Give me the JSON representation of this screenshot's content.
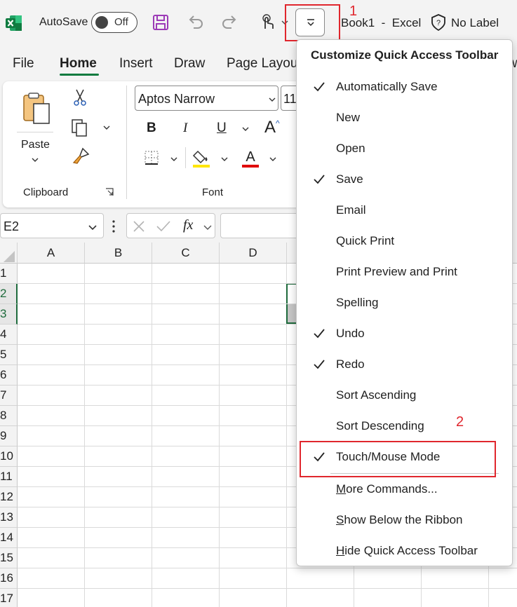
{
  "titlebar": {
    "autosave_label": "AutoSave",
    "autosave_state": "Off",
    "book_title": "Book1  -  Excel",
    "sensitivity_label": "No Label",
    "icons": [
      "excel-logo-icon",
      "save-icon",
      "undo-icon",
      "redo-icon",
      "touch-mode-icon",
      "customize-qat-icon",
      "sensitivity-shield-icon"
    ]
  },
  "menubar": {
    "tabs": [
      "File",
      "Home",
      "Insert",
      "Draw",
      "Page Layout"
    ],
    "active_tab": "Home",
    "overflow_text": "w"
  },
  "ribbon": {
    "paste_label": "Paste",
    "clipboard_label": "Clipboard",
    "font_label": "Font",
    "font_name": "Aptos Narrow",
    "font_size": "11",
    "accent_fill_color": "#ffe600",
    "accent_font_color": "#e00000"
  },
  "formulabar": {
    "name_box": "E2",
    "fx_label": "fx"
  },
  "grid": {
    "columns": [
      "A",
      "B",
      "C",
      "D"
    ],
    "rows": [
      "1",
      "2",
      "3",
      "4",
      "5",
      "6",
      "7",
      "8",
      "9",
      "10",
      "11",
      "12",
      "13",
      "14",
      "15",
      "16",
      "17"
    ],
    "selected_rows": [
      "2",
      "3"
    ],
    "selection_color": "#1e6b3c"
  },
  "qat_menu": {
    "heading": "Customize Quick Access Toolbar",
    "items": [
      {
        "label": "Automatically Save",
        "checked": true
      },
      {
        "label": "New",
        "checked": false
      },
      {
        "label": "Open",
        "checked": false
      },
      {
        "label": "Save",
        "checked": true
      },
      {
        "label": "Email",
        "checked": false
      },
      {
        "label": "Quick Print",
        "checked": false
      },
      {
        "label": "Print Preview and Print",
        "checked": false
      },
      {
        "label": "Spelling",
        "checked": false
      },
      {
        "label": "Undo",
        "checked": true
      },
      {
        "label": "Redo",
        "checked": true
      },
      {
        "label": "Sort Ascending",
        "checked": false
      },
      {
        "label": "Sort Descending",
        "checked": false
      },
      {
        "label": "Touch/Mouse Mode",
        "checked": true
      }
    ],
    "commands": [
      {
        "label": "More Commands...",
        "accel": "M",
        "rest": "ore Commands..."
      },
      {
        "label": "Show Below the Ribbon",
        "accel": "S",
        "rest": "how Below the Ribbon"
      },
      {
        "label": "Hide Quick Access Toolbar",
        "accel": "H",
        "rest": "ide Quick Access Toolbar"
      }
    ]
  },
  "annotations": {
    "step1": "1",
    "step2": "2",
    "color": "#e0262d"
  }
}
